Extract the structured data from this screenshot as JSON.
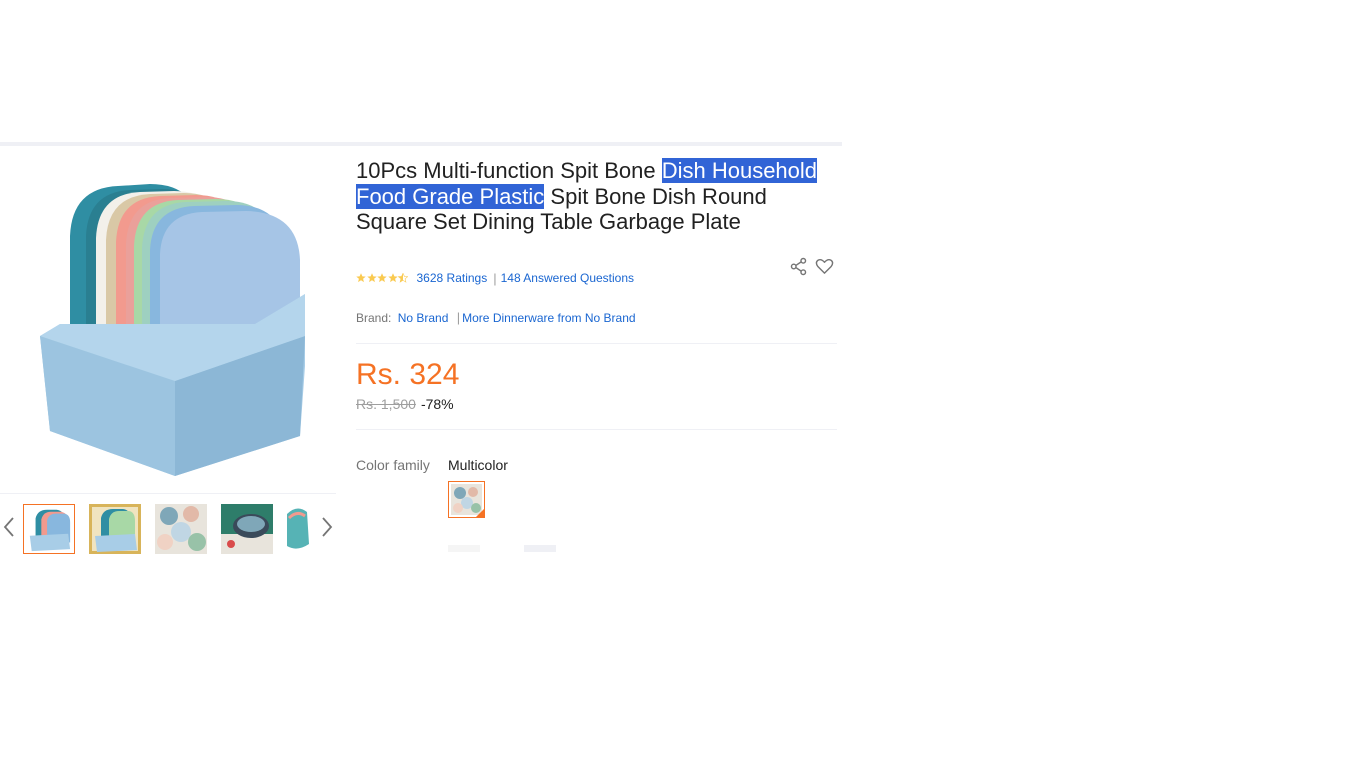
{
  "product": {
    "title_parts": {
      "before": "10Pcs Multi-function Spit Bone ",
      "highlighted": "Dish Household Food Grade Plastic",
      "after": " Spit Bone Dish Round Square Set Dining Table Garbage Plate"
    },
    "rating": {
      "stars": 4.5,
      "ratings_text": "3628 Ratings",
      "questions_text": "148 Answered Questions",
      "separator": "|"
    },
    "brand": {
      "label": "Brand:",
      "name": "No Brand",
      "separator": "|",
      "more_link": "More Dinnerware from No Brand"
    },
    "price": {
      "current": "Rs. 324",
      "original": "Rs. 1,500",
      "discount": "-78%"
    },
    "color": {
      "label": "Color family",
      "value": "Multicolor"
    }
  },
  "gallery": {
    "thumbnail_count": 5,
    "active_index": 0
  },
  "colors": {
    "accent": "#f57224",
    "link": "#1a66d1",
    "highlight": "#3164d6",
    "star": "#faca51"
  },
  "icons": [
    "share-icon",
    "heart-icon",
    "chevron-left-icon",
    "chevron-right-icon",
    "star-icon"
  ]
}
